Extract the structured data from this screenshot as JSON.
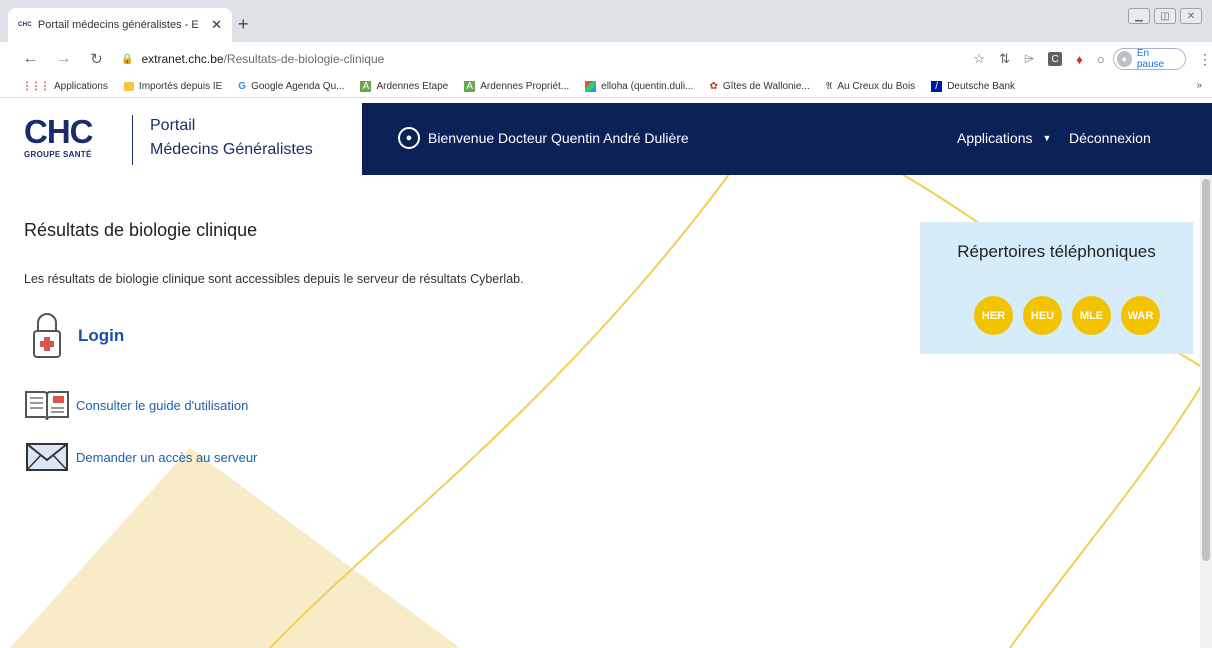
{
  "browser": {
    "tab_title": "Portail médecins généralistes - E",
    "tab_favicon": "CHC",
    "tab_close": "✕",
    "new_tab": "+",
    "url_host": "extranet.chc.be",
    "url_path": "/Resultats-de-biologie-clinique",
    "profile_label": "En pause",
    "bookmarks": [
      {
        "icon": "apps-grid-icon",
        "label": "Applications"
      },
      {
        "icon": "folder-icon",
        "label": "Importés depuis IE"
      },
      {
        "icon": "google-icon",
        "label": "Google Agenda Qu..."
      },
      {
        "icon": "green-square-icon",
        "label": "Ardennes Etape"
      },
      {
        "icon": "green-square-icon",
        "label": "Ardennes Propriét..."
      },
      {
        "icon": "multicolor-icon",
        "label": "elloha (quentin.duli..."
      },
      {
        "icon": "wallonie-icon",
        "label": "Gîtes de Wallonie..."
      },
      {
        "icon": "au-creux-icon",
        "label": "Au Creux du Bois"
      },
      {
        "icon": "deutsche-bank-icon",
        "label": "Deutsche Bank"
      }
    ],
    "bookmarks_more": "»"
  },
  "site": {
    "logo_text": "CHC",
    "logo_sub": "GROUPE SANTÉ",
    "portal_line1": "Portail",
    "portal_line2": "Médecins Généralistes",
    "welcome": "Bienvenue Docteur Quentin André Dulière",
    "nav_applications": "Applications",
    "nav_logout": "Déconnexion"
  },
  "content": {
    "title": "Résultats de biologie clinique",
    "intro": "Les résultats de biologie clinique sont accessibles depuis le serveur de résultats Cyberlab.",
    "login_label": "Login",
    "guide_label": "Consulter le guide d'utilisation",
    "access_label": "Demander un accès au serveur"
  },
  "phone_directory": {
    "title": "Répertoires téléphoniques",
    "sites": [
      "HER",
      "HEU",
      "MLE",
      "WAR"
    ]
  },
  "colors": {
    "navbar": "#0c2158",
    "brand": "#1a2d6b",
    "link": "#1b5fb0",
    "site_button": "#f4c300",
    "phone_box": "#d6ecfa"
  }
}
